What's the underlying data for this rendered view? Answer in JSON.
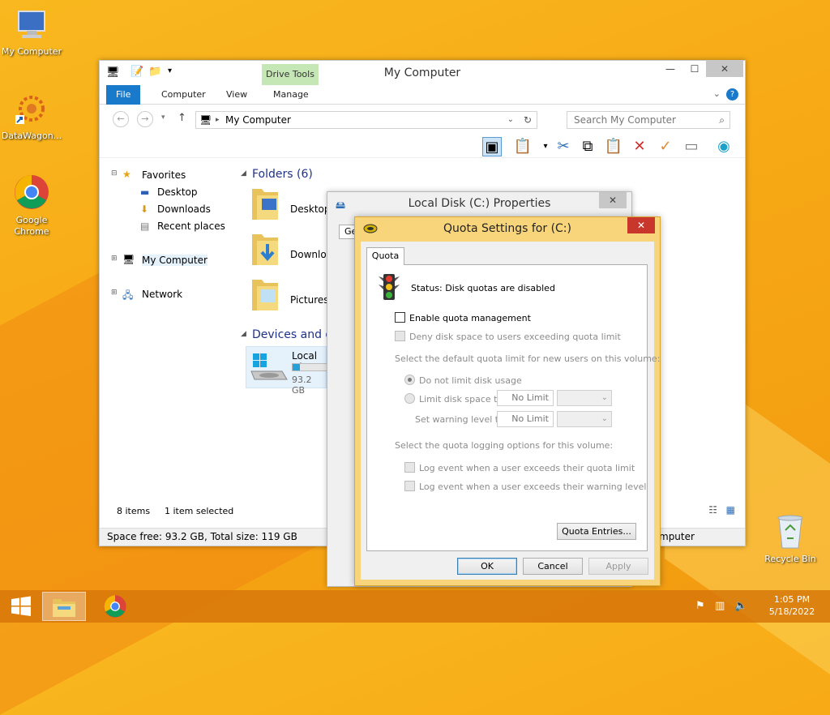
{
  "desktop": {
    "icons": [
      {
        "label": "My Computer"
      },
      {
        "label": "DataWagon..."
      },
      {
        "label": "Google Chrome"
      },
      {
        "label": "Recycle Bin"
      }
    ]
  },
  "explorer": {
    "title": "My Computer",
    "context_tab": "Drive Tools",
    "tabs": [
      "File",
      "Computer",
      "View",
      "Manage"
    ],
    "address": "My Computer",
    "search_placeholder": "Search My Computer",
    "nav": {
      "favorites": "Favorites",
      "favorites_items": [
        "Desktop",
        "Downloads",
        "Recent places"
      ],
      "my_computer": "My Computer",
      "network": "Network"
    },
    "groups": {
      "folders": "Folders (6)",
      "devices": "Devices and d"
    },
    "folders": [
      "Desktop",
      "Downlo",
      "Pictures"
    ],
    "drive": {
      "name": "Local Di",
      "size": "93.2 GB",
      "used_fraction": 0.22
    },
    "status": {
      "items": "8 items",
      "selected": "1 item selected",
      "info": "Space free: 93.2 GB, Total size: 119 GB",
      "info_right": "mputer"
    }
  },
  "properties": {
    "title": "Local Disk (C:) Properties",
    "tab_stub": "Ge"
  },
  "quota": {
    "title": "Quota Settings for  (C:)",
    "tab": "Quota",
    "status": "Status:  Disk quotas are disabled",
    "enable": "Enable quota management",
    "deny": "Deny disk space to users exceeding quota limit",
    "select_default": "Select the default quota limit for new users on this volume:",
    "no_limit_option": "Do not limit disk usage",
    "limit_option": "Limit disk space to",
    "warning_label": "Set warning level to",
    "limit_value": "No Limit",
    "warning_value": "No Limit",
    "select_logging": "Select the quota logging options for this volume:",
    "log_limit": "Log event when a user exceeds their quota limit",
    "log_warning": "Log event when a user exceeds their warning level",
    "entries_button": "Quota Entries...",
    "ok": "OK",
    "cancel": "Cancel",
    "apply": "Apply"
  },
  "taskbar": {
    "time": "1:05 PM",
    "date": "5/18/2022"
  },
  "colors": {
    "accent": "#1979ca",
    "dialog_frame": "#f8d57b",
    "close_red": "#c9372c"
  }
}
